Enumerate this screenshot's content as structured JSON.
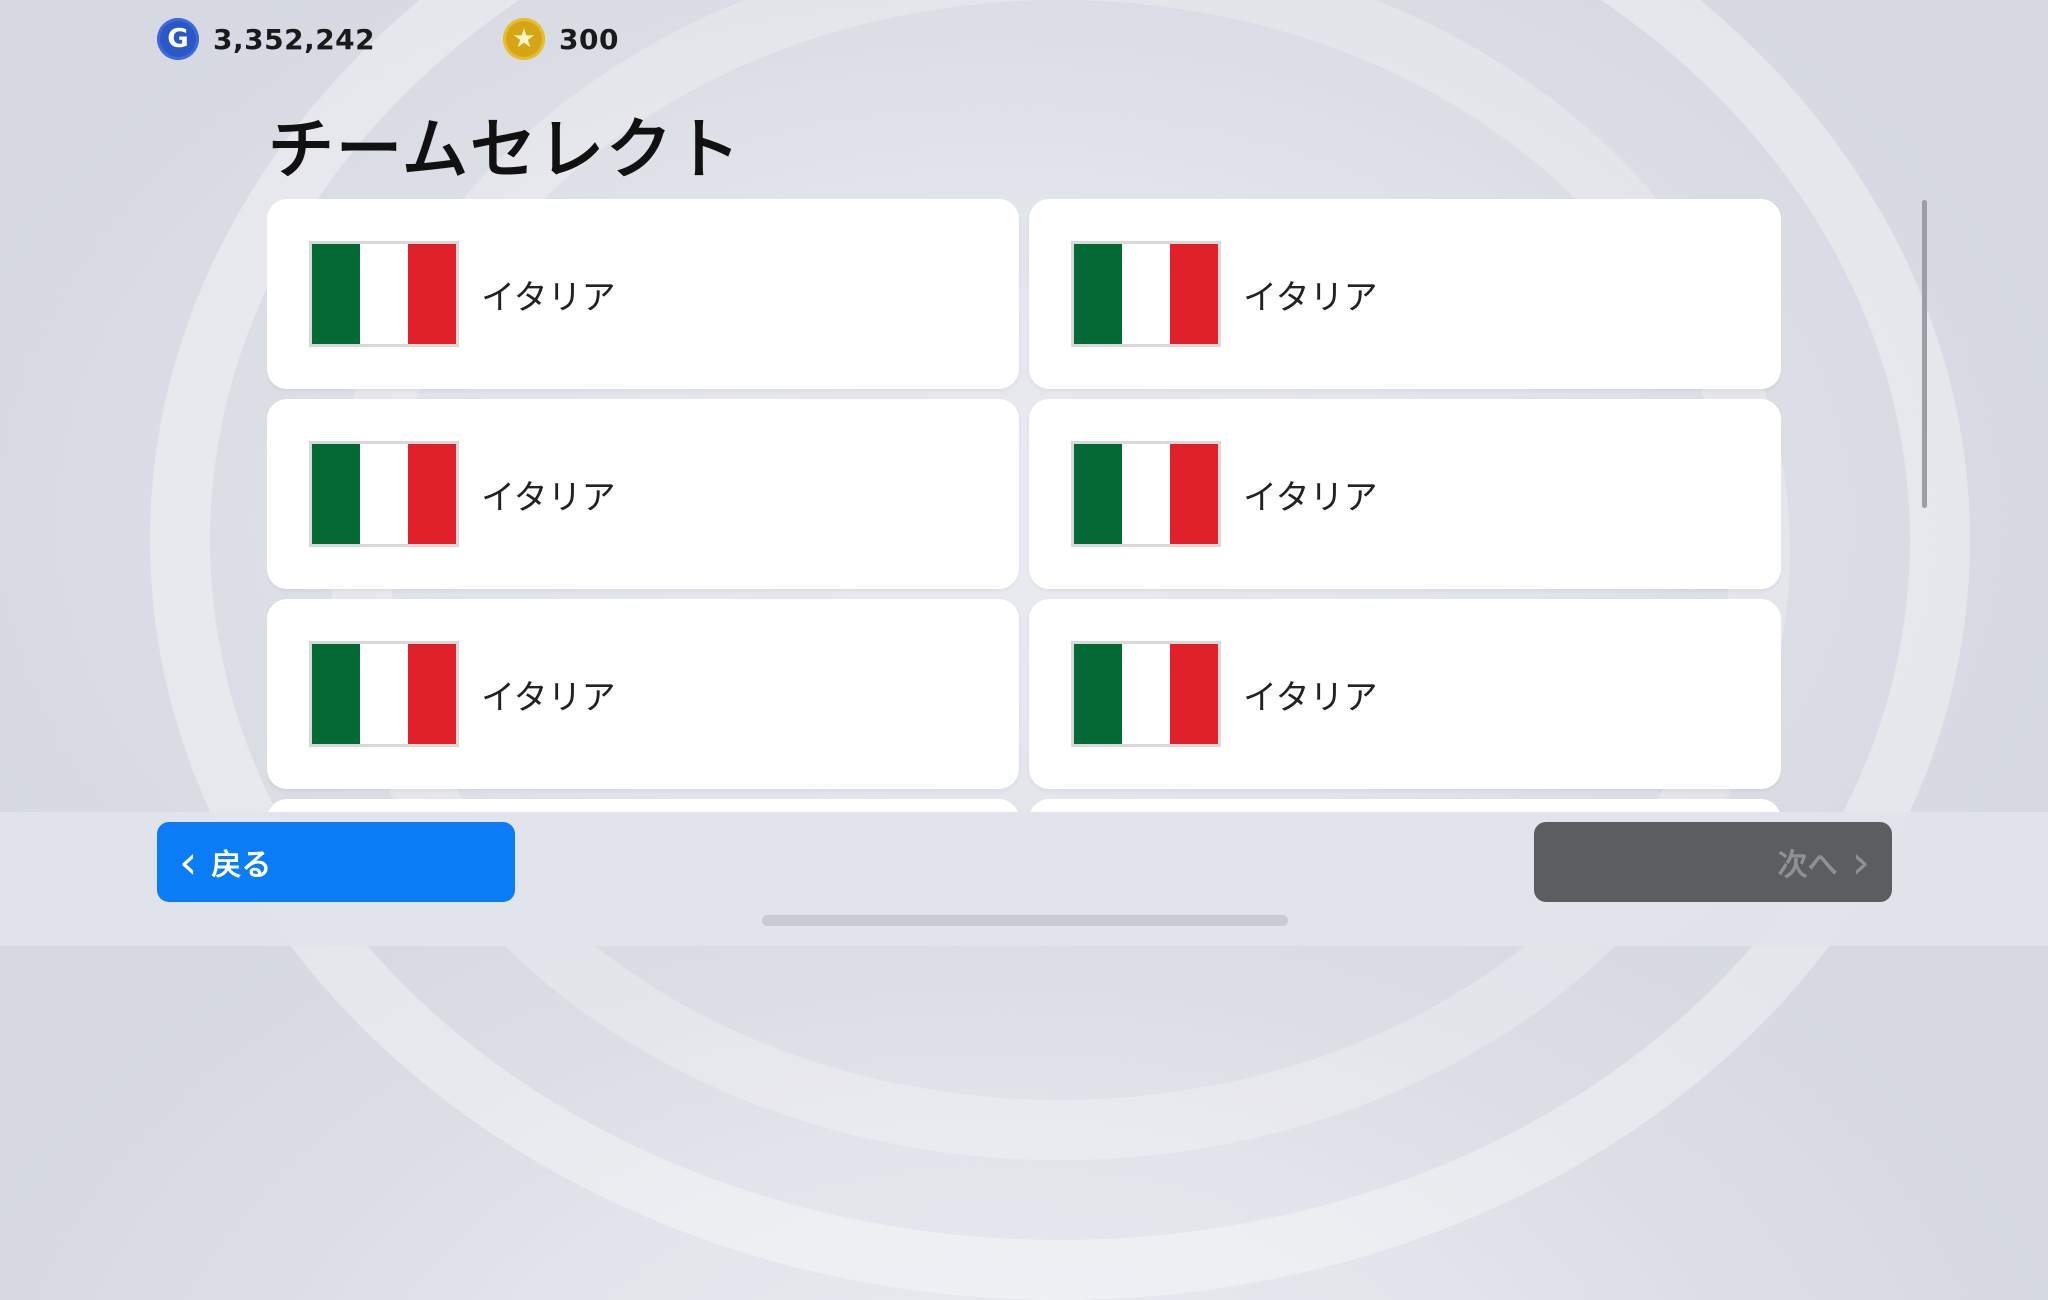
{
  "currency": {
    "gp_icon": "G",
    "gp_amount": "3,352,242",
    "coin_icon": "★",
    "coin_amount": "300"
  },
  "page": {
    "title": "チームセレクト"
  },
  "teams": [
    {
      "name": "イタリア"
    },
    {
      "name": "イタリア"
    },
    {
      "name": "イタリア"
    },
    {
      "name": "イタリア"
    },
    {
      "name": "イタリア"
    },
    {
      "name": "イタリア"
    }
  ],
  "footer": {
    "back_label": "戻る",
    "back_icon": "‹",
    "next_label": "次へ",
    "next_icon": "›"
  },
  "colors": {
    "accent": "#0a7cf5",
    "disabled_button": "#5c5d60",
    "flag_green": "#036a35",
    "flag_white": "#ffffff",
    "flag_red": "#e0212a"
  }
}
